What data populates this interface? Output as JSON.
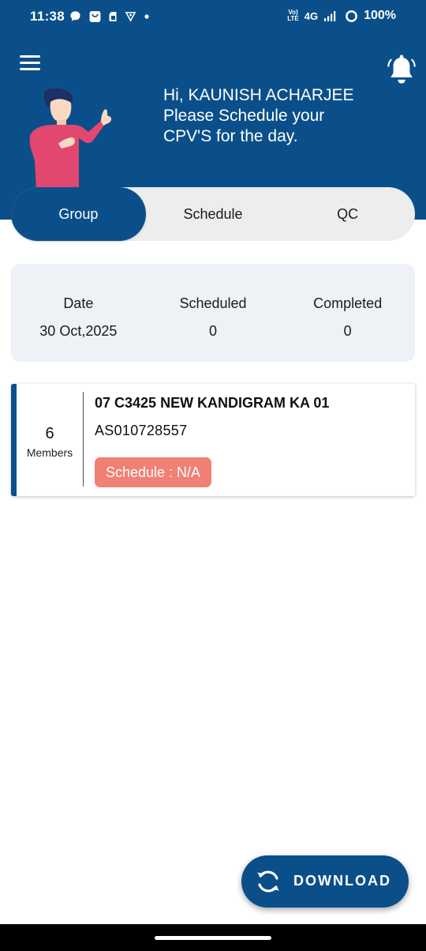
{
  "status_bar": {
    "time": "11:38",
    "network": "4G",
    "volte": "Vo)\nLTE",
    "battery": "100%",
    "left_icons": [
      "chat-bubble-icon",
      "shopping-bag-icon",
      "sim-card-icon",
      "vpn-shield-icon",
      "dot-icon"
    ],
    "right_icons": [
      "volte-icon",
      "signal-icon",
      "battery-ring-icon"
    ]
  },
  "header": {
    "greeting_line1": "Hi, KAUNISH ACHARJEE",
    "greeting_line2": "Please Schedule your",
    "greeting_line3": "CPV'S for the day.",
    "menu_icon": "hamburger-menu-icon",
    "bell_icon": "bell-icon",
    "brand_color": "#0b4f8a"
  },
  "tabs": [
    {
      "label": "Group",
      "active": true
    },
    {
      "label": "Schedule",
      "active": false
    },
    {
      "label": "QC",
      "active": false
    }
  ],
  "summary": {
    "date_label": "Date",
    "date_value": "30 Oct,2025",
    "scheduled_label": "Scheduled",
    "scheduled_value": "0",
    "completed_label": "Completed",
    "completed_value": "0"
  },
  "groups": [
    {
      "members_count": "6",
      "members_label": "Members",
      "name": "07 C3425 NEW KANDIGRAM KA 01",
      "code": "AS010728557",
      "schedule_badge": "Schedule : N/A",
      "badge_color": "#f08074"
    }
  ],
  "download": {
    "label": "DOWNLOAD",
    "icon": "sync-icon"
  }
}
